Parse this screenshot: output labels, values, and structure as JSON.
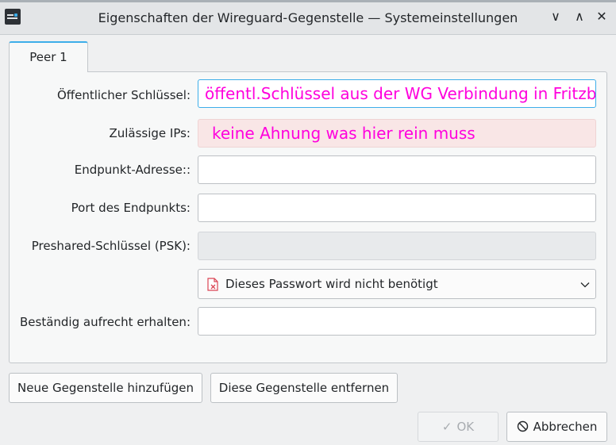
{
  "window": {
    "title": "Eigenschaften der Wireguard-Gegenstelle — Systemeinstellungen",
    "controls": {
      "minimize": "∨",
      "maximize": "∧",
      "close": "✕"
    }
  },
  "tabs": [
    {
      "label": "Peer 1",
      "active": true
    }
  ],
  "form": {
    "public_key": {
      "label": "Öffentlicher Schlüssel:",
      "value": "öffentl.Schlüssel aus der WG Verbindung in Fritzbox"
    },
    "allowed_ips": {
      "label": "Zulässige IPs:",
      "value": "keine Ahnung was hier rein muss"
    },
    "endpoint_address": {
      "label": "Endpunkt-Adresse::",
      "value": ""
    },
    "endpoint_port": {
      "label": "Port des Endpunkts:",
      "value": ""
    },
    "psk": {
      "label": "Preshared-Schlüssel (PSK):",
      "value": ""
    },
    "password_option": {
      "value": "Dieses Passwort wird nicht benötigt",
      "icon": "document-error-icon"
    },
    "keepalive": {
      "label": "Beständig aufrecht erhalten:",
      "value": ""
    }
  },
  "buttons": {
    "add_peer": "Neue Gegenstelle hinzufügen",
    "remove_peer": "Diese Gegenstelle entfernen",
    "ok": "OK",
    "ok_glyph": "✓",
    "cancel": "Abbrechen"
  },
  "colors": {
    "accent": "#3daee9",
    "annotation_text": "#ff00dd",
    "error_field_bg": "#f9e6e6"
  }
}
